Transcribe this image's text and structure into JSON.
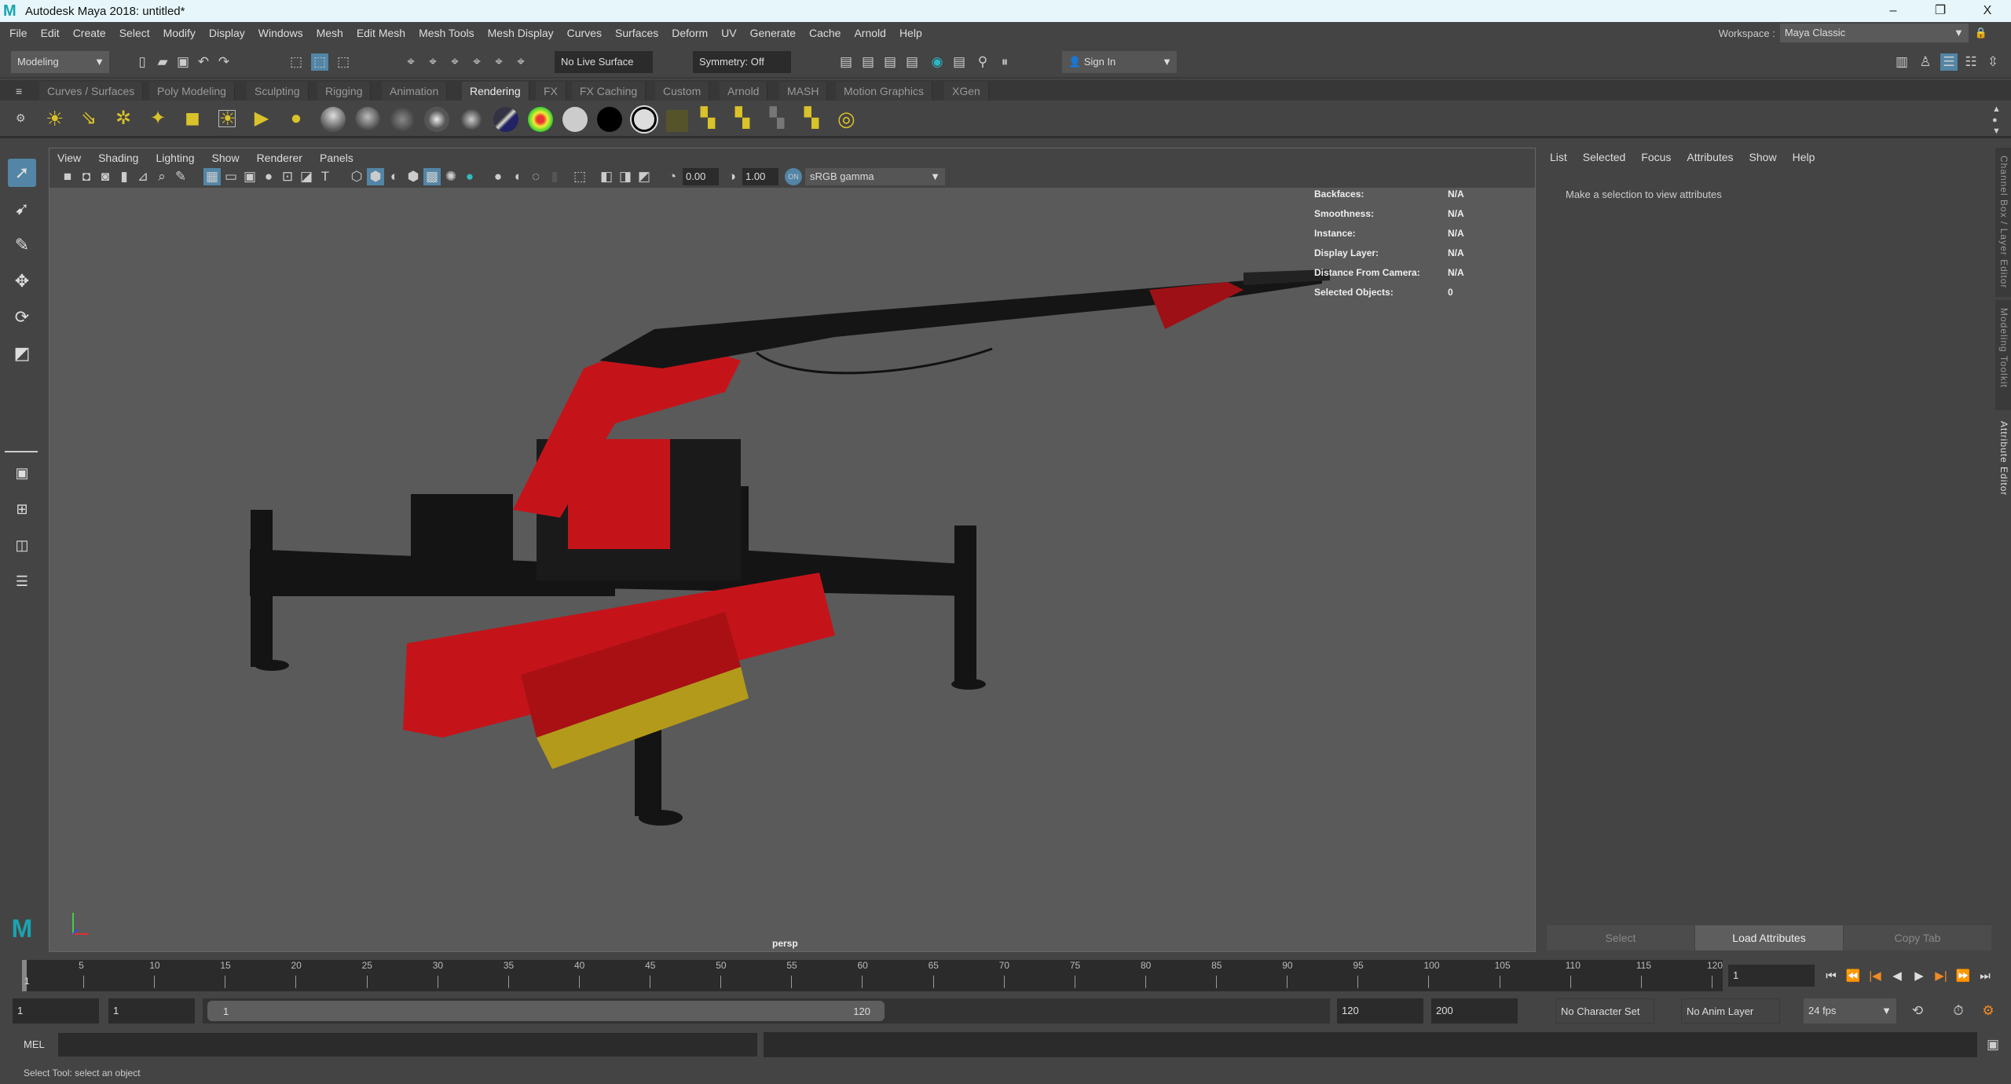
{
  "window": {
    "title": "Autodesk Maya 2018: untitled*",
    "minimize": "–",
    "restore": "❐",
    "close": "X"
  },
  "menubar": [
    "File",
    "Edit",
    "Create",
    "Select",
    "Modify",
    "Display",
    "Windows",
    "Mesh",
    "Edit Mesh",
    "Mesh Tools",
    "Mesh Display",
    "Curves",
    "Surfaces",
    "Deform",
    "UV",
    "Generate",
    "Cache",
    "Arnold",
    "Help"
  ],
  "workspace": {
    "label": "Workspace :",
    "value": "Maya Classic"
  },
  "statusline": {
    "menuset": "Modeling",
    "live_surface": "No Live Surface",
    "symmetry": "Symmetry: Off",
    "sign_in": "Sign In"
  },
  "shelf_tabs": [
    "Curves / Surfaces",
    "Poly Modeling",
    "Sculpting",
    "Rigging",
    "Animation",
    "Rendering",
    "FX",
    "FX Caching",
    "Custom",
    "Arnold",
    "MASH",
    "Motion Graphics",
    "XGen"
  ],
  "shelf_active": "Rendering",
  "viewport": {
    "menu": [
      "View",
      "Shading",
      "Lighting",
      "Show",
      "Renderer",
      "Panels"
    ],
    "exposure": "0.00",
    "gamma": "1.00",
    "colorspace": "sRGB gamma",
    "camera": "persp",
    "hud": [
      {
        "label": "Backfaces:",
        "value": "N/A"
      },
      {
        "label": "Smoothness:",
        "value": "N/A"
      },
      {
        "label": "Instance:",
        "value": "N/A"
      },
      {
        "label": "Display Layer:",
        "value": "N/A"
      },
      {
        "label": "Distance From Camera:",
        "value": "N/A"
      },
      {
        "label": "Selected Objects:",
        "value": "0"
      }
    ]
  },
  "attribute_editor": {
    "menu": [
      "List",
      "Selected",
      "Focus",
      "Attributes",
      "Show",
      "Help"
    ],
    "message": "Make a selection to view attributes",
    "buttons": {
      "select": "Select",
      "load": "Load Attributes",
      "copy": "Copy Tab"
    }
  },
  "side_tabs": [
    "Channel Box / Layer Editor",
    "Modeling Toolkit",
    "Attribute Editor"
  ],
  "timeslider": {
    "ticks": [
      "5",
      "10",
      "15",
      "20",
      "25",
      "30",
      "35",
      "40",
      "45",
      "50",
      "55",
      "60",
      "65",
      "70",
      "75",
      "80",
      "85",
      "90",
      "95",
      "100",
      "105",
      "110",
      "115",
      "120"
    ],
    "current_marker": "1",
    "current_frame": "1"
  },
  "range": {
    "start": "1",
    "playback_start": "1",
    "slider_start": "1",
    "slider_end": "120",
    "playback_end": "120",
    "end": "200",
    "character_set": "No Character Set",
    "anim_layer": "No Anim Layer",
    "fps": "24 fps"
  },
  "cmdline": {
    "label": "MEL"
  },
  "helpline": "Select Tool: select an object",
  "colors": {
    "accent": "#5285a6",
    "crane_red": "#c4141a",
    "viewport_bg": "#5a5a5a"
  }
}
